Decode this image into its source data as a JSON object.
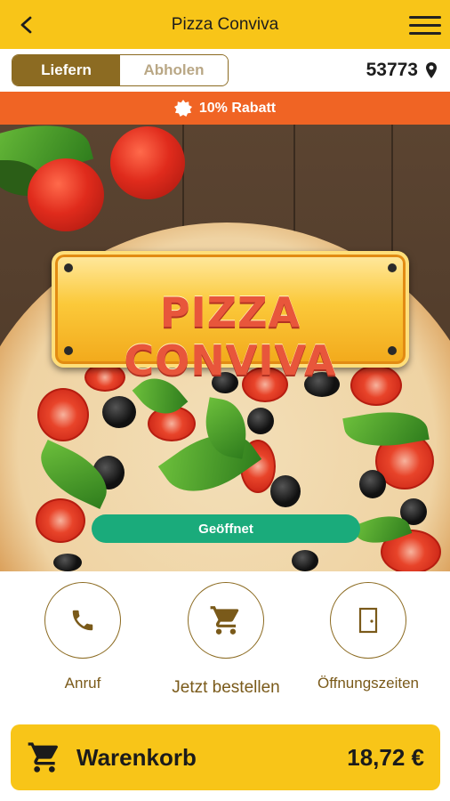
{
  "header": {
    "title": "Pizza Conviva"
  },
  "mode": {
    "deliver_label": "Liefern",
    "pickup_label": "Abholen",
    "postal_code": "53773"
  },
  "promo": {
    "label": "10% Rabatt"
  },
  "hero": {
    "brand": "PIZZA CONVIVA",
    "status": "Geöffnet"
  },
  "actions": [
    {
      "label": "Anruf"
    },
    {
      "label": "Jetzt bestellen"
    },
    {
      "label": "Öffnungszeiten"
    }
  ],
  "cart": {
    "label": "Warenkorb",
    "total": "18,72 €"
  },
  "colors": {
    "primary": "#f8c518",
    "brown": "#8c6b22",
    "promo": "#f06424",
    "open": "#1aab7b"
  }
}
